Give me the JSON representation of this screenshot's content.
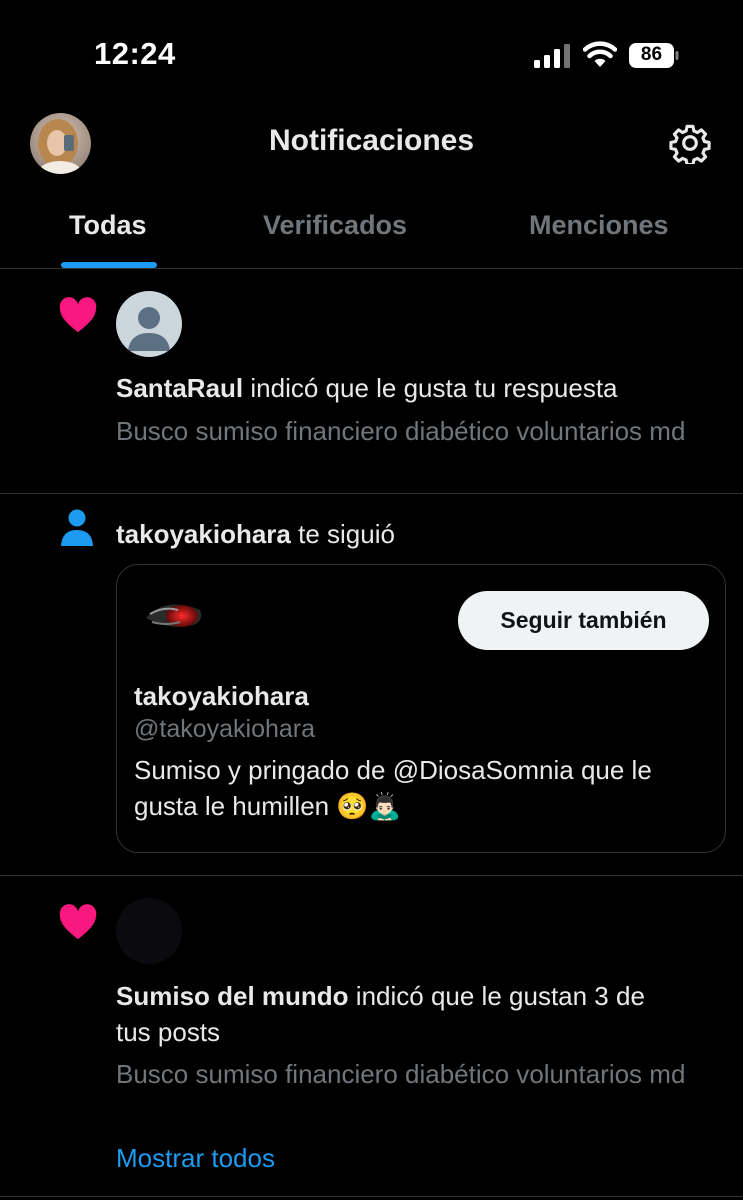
{
  "status_bar": {
    "time": "12:24",
    "battery": "86"
  },
  "header": {
    "title": "Notificaciones"
  },
  "tabs": [
    {
      "label": "Todas",
      "active": true
    },
    {
      "label": "Verificados",
      "active": false
    },
    {
      "label": "Menciones",
      "active": false
    }
  ],
  "notifications": [
    {
      "type": "like",
      "username": "SantaRaul",
      "action": " indicó que le gusta tu respuesta",
      "context": "Busco sumiso financiero diabético voluntarios md"
    },
    {
      "type": "follow",
      "username": "takoyakiohara",
      "action": " te siguió",
      "card": {
        "name": "takoyakiohara",
        "handle": "@takoyakiohara",
        "bio": "Sumiso y pringado de @DiosaSomnia que le gusta le humillen 🥺🙇🏻‍♂️",
        "follow_button": "Seguir también"
      }
    },
    {
      "type": "like",
      "username": "Sumiso del mundo",
      "action_line1": " indicó que le gustan 3 de",
      "action_line2": "tus posts",
      "context": "Busco sumiso financiero diabético voluntarios md",
      "show_all": "Mostrar todos"
    }
  ],
  "colors": {
    "accent": "#1d9bf0",
    "like": "#f91880",
    "muted": "#71767b",
    "divider": "#2f3336"
  },
  "icons": [
    "signal-icon",
    "wifi-icon",
    "battery-icon",
    "settings-gear-icon",
    "heart-icon",
    "person-icon",
    "default-avatar-icon"
  ]
}
